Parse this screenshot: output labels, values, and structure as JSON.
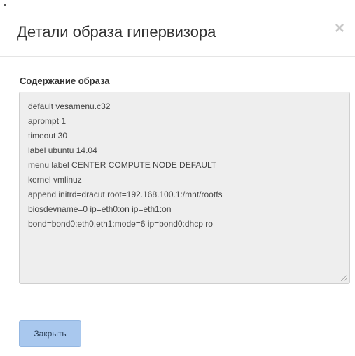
{
  "dialog": {
    "title": "Детали образа гипервизора",
    "close_icon_glyph": "×"
  },
  "body": {
    "field_label": "Содержание образа",
    "content_lines": [
      "default vesamenu.c32",
      "aprompt 1",
      "timeout 30",
      "label ubuntu 14.04",
      "menu label CENTER COMPUTE NODE DEFAULT",
      "kernel vmlinuz",
      "append initrd=dracut root=192.168.100.1:/mnt/rootfs",
      "biosdevname=0 ip=eth0:on ip=eth1:on",
      "bond=bond0:eth0,eth1:mode=6 ip=bond0:dhcp ro"
    ]
  },
  "footer": {
    "close_button_label": "Закрыть"
  },
  "colors": {
    "button_bg": "#a9c8ee",
    "textarea_bg": "#eeeeee"
  }
}
